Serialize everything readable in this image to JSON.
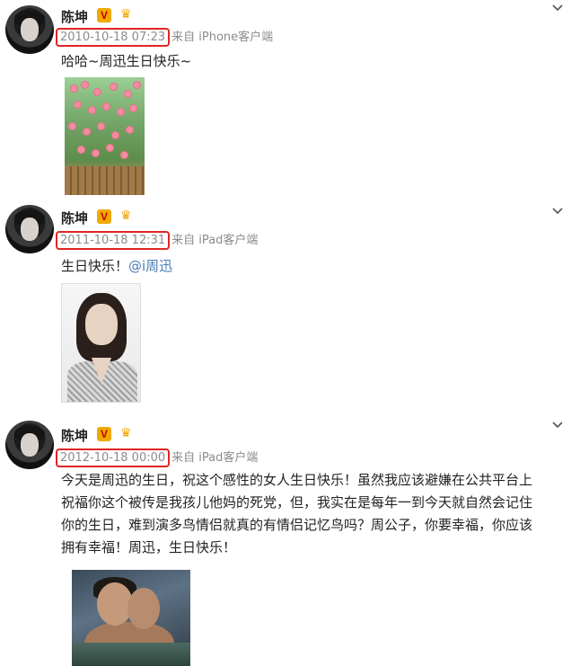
{
  "posts": [
    {
      "username": "陈坤",
      "vip_badge": "V",
      "time": "2010-10-18 07:23",
      "source": "来自 iPhone客户端",
      "text": "哈哈~周迅生日快乐~",
      "image": "flower-garden-photo"
    },
    {
      "username": "陈坤",
      "vip_badge": "V",
      "time": "2011-10-18 12:31",
      "source": "来自 iPad客户端",
      "text": "生日快乐！",
      "mention": "@i周迅",
      "image": "portrait-photo"
    },
    {
      "username": "陈坤",
      "vip_badge": "V",
      "time": "2012-10-18 00:00",
      "source": "来自 iPad客户端",
      "text_lines": [
        "今天是周迅的生日，祝这个感性的女人生日快乐！虽然我应该避嫌在公共平台上",
        "祝福你这个被传是我孩儿他妈的死党，但，我实在是每年一到今天就自然会记住",
        "你的生日，难到演多鸟情侣就真的有情侣记忆鸟吗？周公子，你要幸福，你应该",
        "拥有幸福！周迅，生日快乐！"
      ],
      "image": "couple-photo"
    }
  ],
  "icons": {
    "chevron": "chevron-down-icon",
    "vip": "vip-badge-icon",
    "crown": "crown-icon"
  },
  "colors": {
    "highlight_box": "#e02424",
    "vip_badge": "#f0a900",
    "mention": "#4a7bb5",
    "meta_text": "#8c8c8c"
  }
}
